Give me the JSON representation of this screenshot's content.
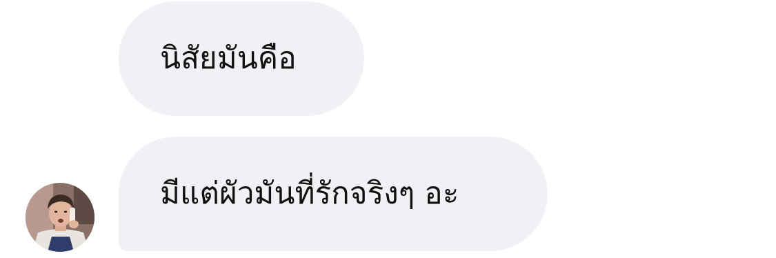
{
  "conversation": {
    "messages": [
      {
        "text": "นิสัยมันคือ"
      },
      {
        "text": "มีแต่ผัวมันที่รักจริงๆ อะ"
      }
    ],
    "sender": {
      "avatar_icon": "user-avatar-photo"
    }
  },
  "colors": {
    "bubble_background": "#eff1f4",
    "message_text": "#111111",
    "page_background": "#ffffff"
  }
}
